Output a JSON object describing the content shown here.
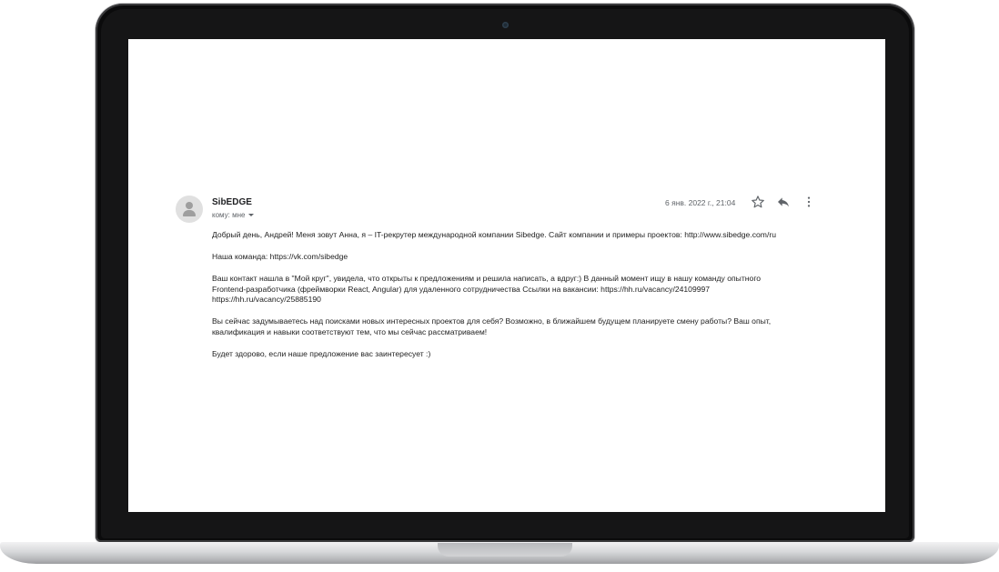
{
  "email": {
    "sender": "SibEDGE",
    "recipient": "кому: мне",
    "date": "6 янв. 2022 г., 21:04",
    "icons": {
      "avatar": "person-icon",
      "star": "star-icon",
      "reply": "reply-icon",
      "more": "more-vertical-icon",
      "recipient_details": "caret-down-icon"
    },
    "paragraphs": [
      "Добрый день, Андрей! Меня зовут Анна, я – IT-рекрутер международной компании Sibedge. Сайт компании и примеры проектов: http://www.sibedge.com/ru",
      "Наша команда: https://vk.com/sibedge",
      "Ваш контакт нашла в \"Мой круг\", увидела, что открыты к предложениям и решила написать, а вдруг:) В данный момент ищу в нашу команду опытного\nFrontend-разработчика (фреймворки React, Angular) для удаленного сотрудничества Ссылки на вакансии: https://hh.ru/vacancy/24109997\nhttps://hh.ru/vacancy/25885190",
      "Вы сейчас задумываетесь над поисками новых интересных проектов для себя? Возможно, в ближайшем будущем планируете смену работы? Ваш опыт,\nквалификация и навыки соответствуют тем, что мы сейчас рассматриваем!",
      "Будет здорово, если наше предложение вас заинтересует :)"
    ]
  }
}
